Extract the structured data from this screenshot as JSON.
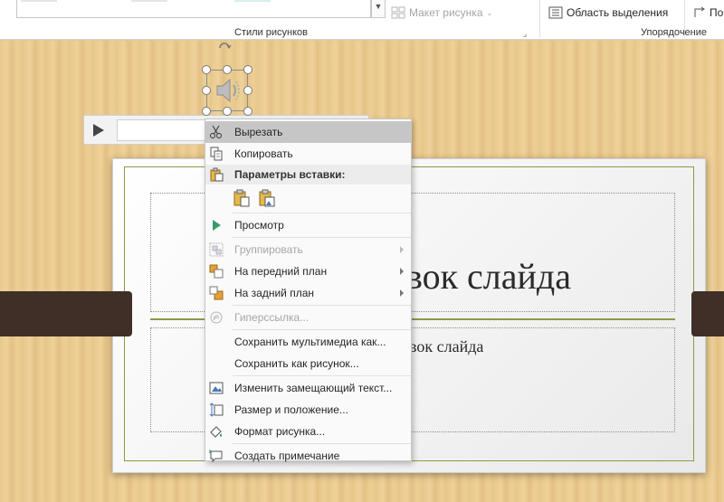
{
  "ribbon": {
    "picture_layout_label": "Макет рисунка",
    "selection_pane_label": "Область выделения",
    "cut_off_label": "По",
    "group_styles_label": "Стили рисунков",
    "group_arrange_label": "Упорядочение"
  },
  "slide": {
    "title_fragment": "вок слайда",
    "subtitle_fragment": "вок слайда"
  },
  "context_menu": {
    "cut": "Вырезать",
    "copy": "Копировать",
    "paste_options_header": "Параметры вставки:",
    "preview": "Просмотр",
    "group": "Группировать",
    "bring_forward": "На передний план",
    "send_backward": "На задний план",
    "hyperlink": "Гиперссылка...",
    "save_media": "Сохранить мультимедиа как...",
    "save_picture": "Сохранить как рисунок...",
    "alt_text": "Изменить замещающий текст...",
    "size_position": "Размер и положение...",
    "format_picture": "Формат рисунка...",
    "new_comment": "Создать примечание"
  },
  "colors": {
    "accent_green": "#8a9a4a",
    "band_brown": "#3f2f26",
    "highlight_gray": "#c6c6c6",
    "preview_green": "#3a9a6a"
  }
}
